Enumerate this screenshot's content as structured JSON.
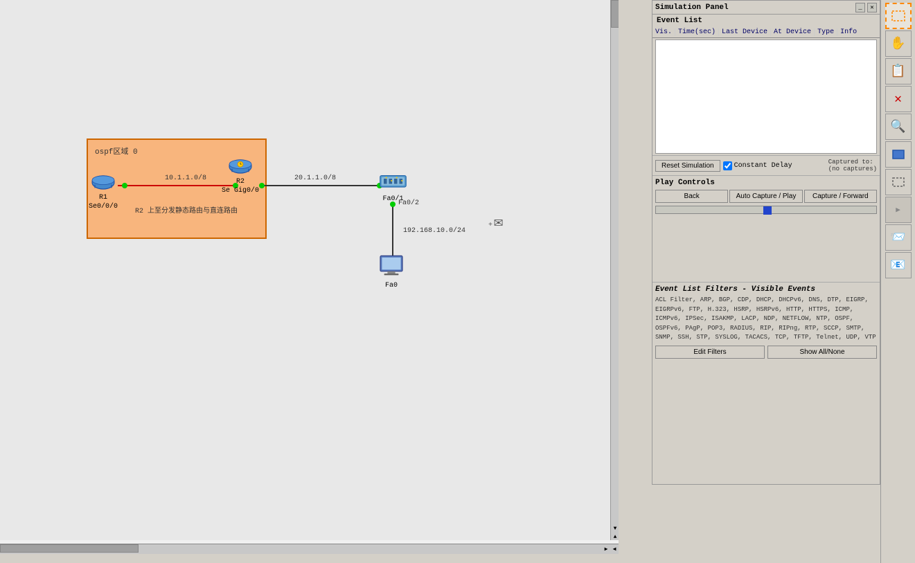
{
  "simPanel": {
    "title": "Simulation Panel",
    "eventList": {
      "sectionTitle": "Event List",
      "columns": [
        "Vis.",
        "Time(sec)",
        "Last Device",
        "At Device",
        "Type",
        "Info"
      ]
    },
    "controls": {
      "resetButton": "Reset Simulation",
      "constantDelay": "Constant Delay",
      "capturedLabel": "Captured to:",
      "capturedValue": "(no captures)"
    },
    "playControls": {
      "title": "Play Controls",
      "backButton": "Back",
      "autoCaptureButton": "Auto Capture / Play",
      "captureForwardButton": "Capture / Forward"
    },
    "eventFilters": {
      "title": "Event List Filters - Visible Events",
      "filterText": "ACL Filter, ARP, BGP, CDP, DHCP, DHCPv6, DNS, DTP, EIGRP, EIGRPv6, FTP, H.323, HSRP, HSRPv6, HTTP, HTTPS, ICMP, ICMPv6, IPSec, ISAKMP, LACP, NDP, NETFLOW, NTP, OSPF, OSPFv6, PAgP, POP3, RADIUS, RIP, RIPng, RTP, SCCP, SMTP, SNMP, SSH, STP, SYSLOG, TACACS, TCP, TFTP, Telnet, UDP, VTP",
      "editFiltersButton": "Edit Filters",
      "showAllButton": "Show All/None"
    }
  },
  "network": {
    "ospfLabel": "ospf区域 0",
    "r1Label": "R1",
    "r1Interface": "Se0/0/0",
    "r2Label": "R2",
    "r2Interface1": "Se Gig0/0",
    "r2Interface2": "10.1.1.0/8",
    "linkLabel1": "20.1.1.0/8",
    "fa01Label": "Fa0/1",
    "fa02Label": "Fa0/2",
    "fa0Label": "Fa0",
    "subnet1": "192.168.10.0/24",
    "r2Note": "R2 上至分发静态路由与直连路由"
  },
  "toolbar": {
    "buttons": [
      {
        "name": "select-cursor",
        "icon": "↖",
        "tooltip": "Select"
      },
      {
        "name": "hand-tool",
        "icon": "✋",
        "tooltip": "Hand"
      },
      {
        "name": "note-tool",
        "icon": "📝",
        "tooltip": "Note"
      },
      {
        "name": "delete-tool",
        "icon": "✕",
        "tooltip": "Delete"
      },
      {
        "name": "zoom-tool",
        "icon": "🔍",
        "tooltip": "Zoom"
      },
      {
        "name": "rect-tool",
        "icon": "▭",
        "tooltip": "Rectangle"
      },
      {
        "name": "dashed-rect",
        "icon": "⬚",
        "tooltip": "Dashed Rect"
      },
      {
        "name": "arrow-tool",
        "icon": "↗",
        "tooltip": "Arrow"
      },
      {
        "name": "mail-in",
        "icon": "📨",
        "tooltip": "Mail In"
      },
      {
        "name": "mail-out",
        "icon": "📧",
        "tooltip": "Mail Out"
      }
    ]
  }
}
